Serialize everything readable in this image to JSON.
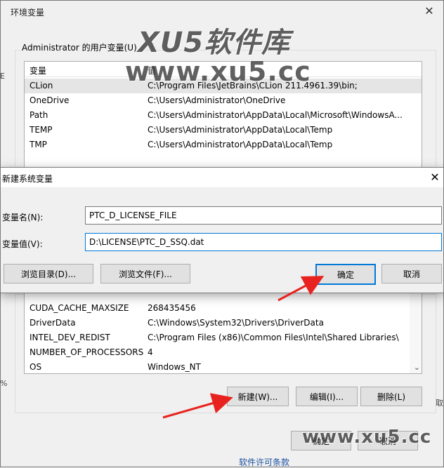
{
  "env_dialog": {
    "title": "环境变量",
    "close_glyph": "✕",
    "user_group_label": "Administrator 的用户变量(U)",
    "user_columns": [
      "变量",
      "值"
    ],
    "user_vars": [
      {
        "name": "CLion",
        "value": "C:\\Program Files\\JetBrains\\CLion 211.4961.39\\bin;"
      },
      {
        "name": "OneDrive",
        "value": "C:\\Users\\Administrator\\OneDrive"
      },
      {
        "name": "Path",
        "value": "C:\\Users\\Administrator\\AppData\\Local\\Microsoft\\WindowsA..."
      },
      {
        "name": "TEMP",
        "value": "C:\\Users\\Administrator\\AppData\\Local\\Temp"
      },
      {
        "name": "TMP",
        "value": "C:\\Users\\Administrator\\AppData\\Local\\Temp"
      }
    ],
    "sys_vars": [
      {
        "name": "CUDA_CACHE_MAXSIZE",
        "value": "268435456"
      },
      {
        "name": "DriverData",
        "value": "C:\\Windows\\System32\\Drivers\\DriverData"
      },
      {
        "name": "INTEL_DEV_REDIST",
        "value": "C:\\Program Files (x86)\\Common Files\\Intel\\Shared Libraries\\"
      },
      {
        "name": "NUMBER_OF_PROCESSORS",
        "value": "4"
      },
      {
        "name": "OS",
        "value": "Windows_NT"
      }
    ],
    "sys_buttons": {
      "new": "新建(W)...",
      "edit": "编辑(I)...",
      "delete": "删除(L)"
    },
    "footer_buttons": {
      "ok": "确定",
      "cancel": "取消"
    },
    "scroll_down_glyph": "⌄"
  },
  "new_dialog": {
    "title": "新建系统变量",
    "close_glyph": "✕",
    "name_label": "变量名(N):",
    "name_value": "PTC_D_LICENSE_FILE",
    "value_label": "变量值(V):",
    "value_value": "D:\\LICENSE\\PTC_D_SSQ.dat",
    "browse_dir": "浏览目录(D)...",
    "browse_file": "浏览文件(F)...",
    "ok": "确定",
    "cancel": "取消"
  },
  "watermarks": {
    "brand": "XU5软件库",
    "url_top": "www.xu5.cc",
    "url_bottom": "www.xu5.cc"
  },
  "edge_fragments": {
    "left_e": "E",
    "left_percent": "%",
    "right_cut": "取",
    "bottom_link": "软件许可条款"
  },
  "colors": {
    "arrow": "#e8231f",
    "accent": "#0078d7"
  }
}
